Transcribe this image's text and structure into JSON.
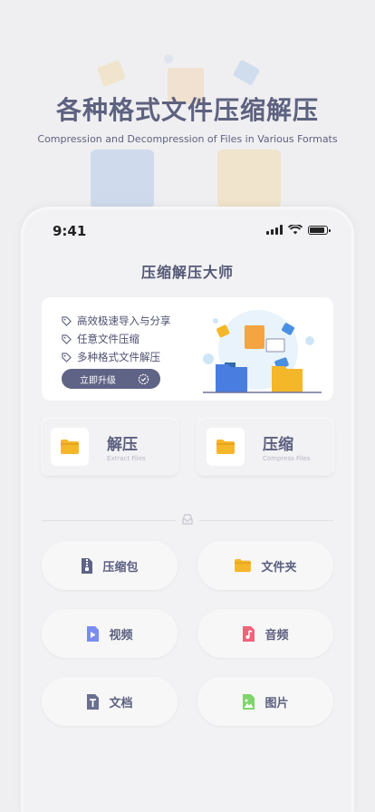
{
  "promo": {
    "title": "各种格式文件压缩解压",
    "subtitle": "Compression and Decompression of Files in Various Formats"
  },
  "status_bar": {
    "time": "9:41"
  },
  "app": {
    "title": "压缩解压大师"
  },
  "banner": {
    "features": [
      "高效极速导入与分享",
      "任意文件压缩",
      "多种格式文件解压"
    ],
    "upgrade_label": "立即升级"
  },
  "actions": [
    {
      "label": "解压",
      "sublabel": "Extract Files",
      "icon": "folder-icon"
    },
    {
      "label": "压缩",
      "sublabel": "Compress Files",
      "icon": "folder-icon"
    }
  ],
  "categories": [
    {
      "label": "压缩包",
      "icon": "zip-icon",
      "color": "#5f6385"
    },
    {
      "label": "文件夹",
      "icon": "folder-icon",
      "color": "#f5b72a"
    },
    {
      "label": "视频",
      "icon": "video-icon",
      "color": "#7b8cf0"
    },
    {
      "label": "音频",
      "icon": "audio-icon",
      "color": "#f2637b"
    },
    {
      "label": "文档",
      "icon": "document-icon",
      "color": "#6b6f8e"
    },
    {
      "label": "图片",
      "icon": "image-icon",
      "color": "#7fd46b"
    }
  ],
  "colors": {
    "accent": "#5f6385",
    "folder": "#f5b72a",
    "background": "#efeff1"
  }
}
